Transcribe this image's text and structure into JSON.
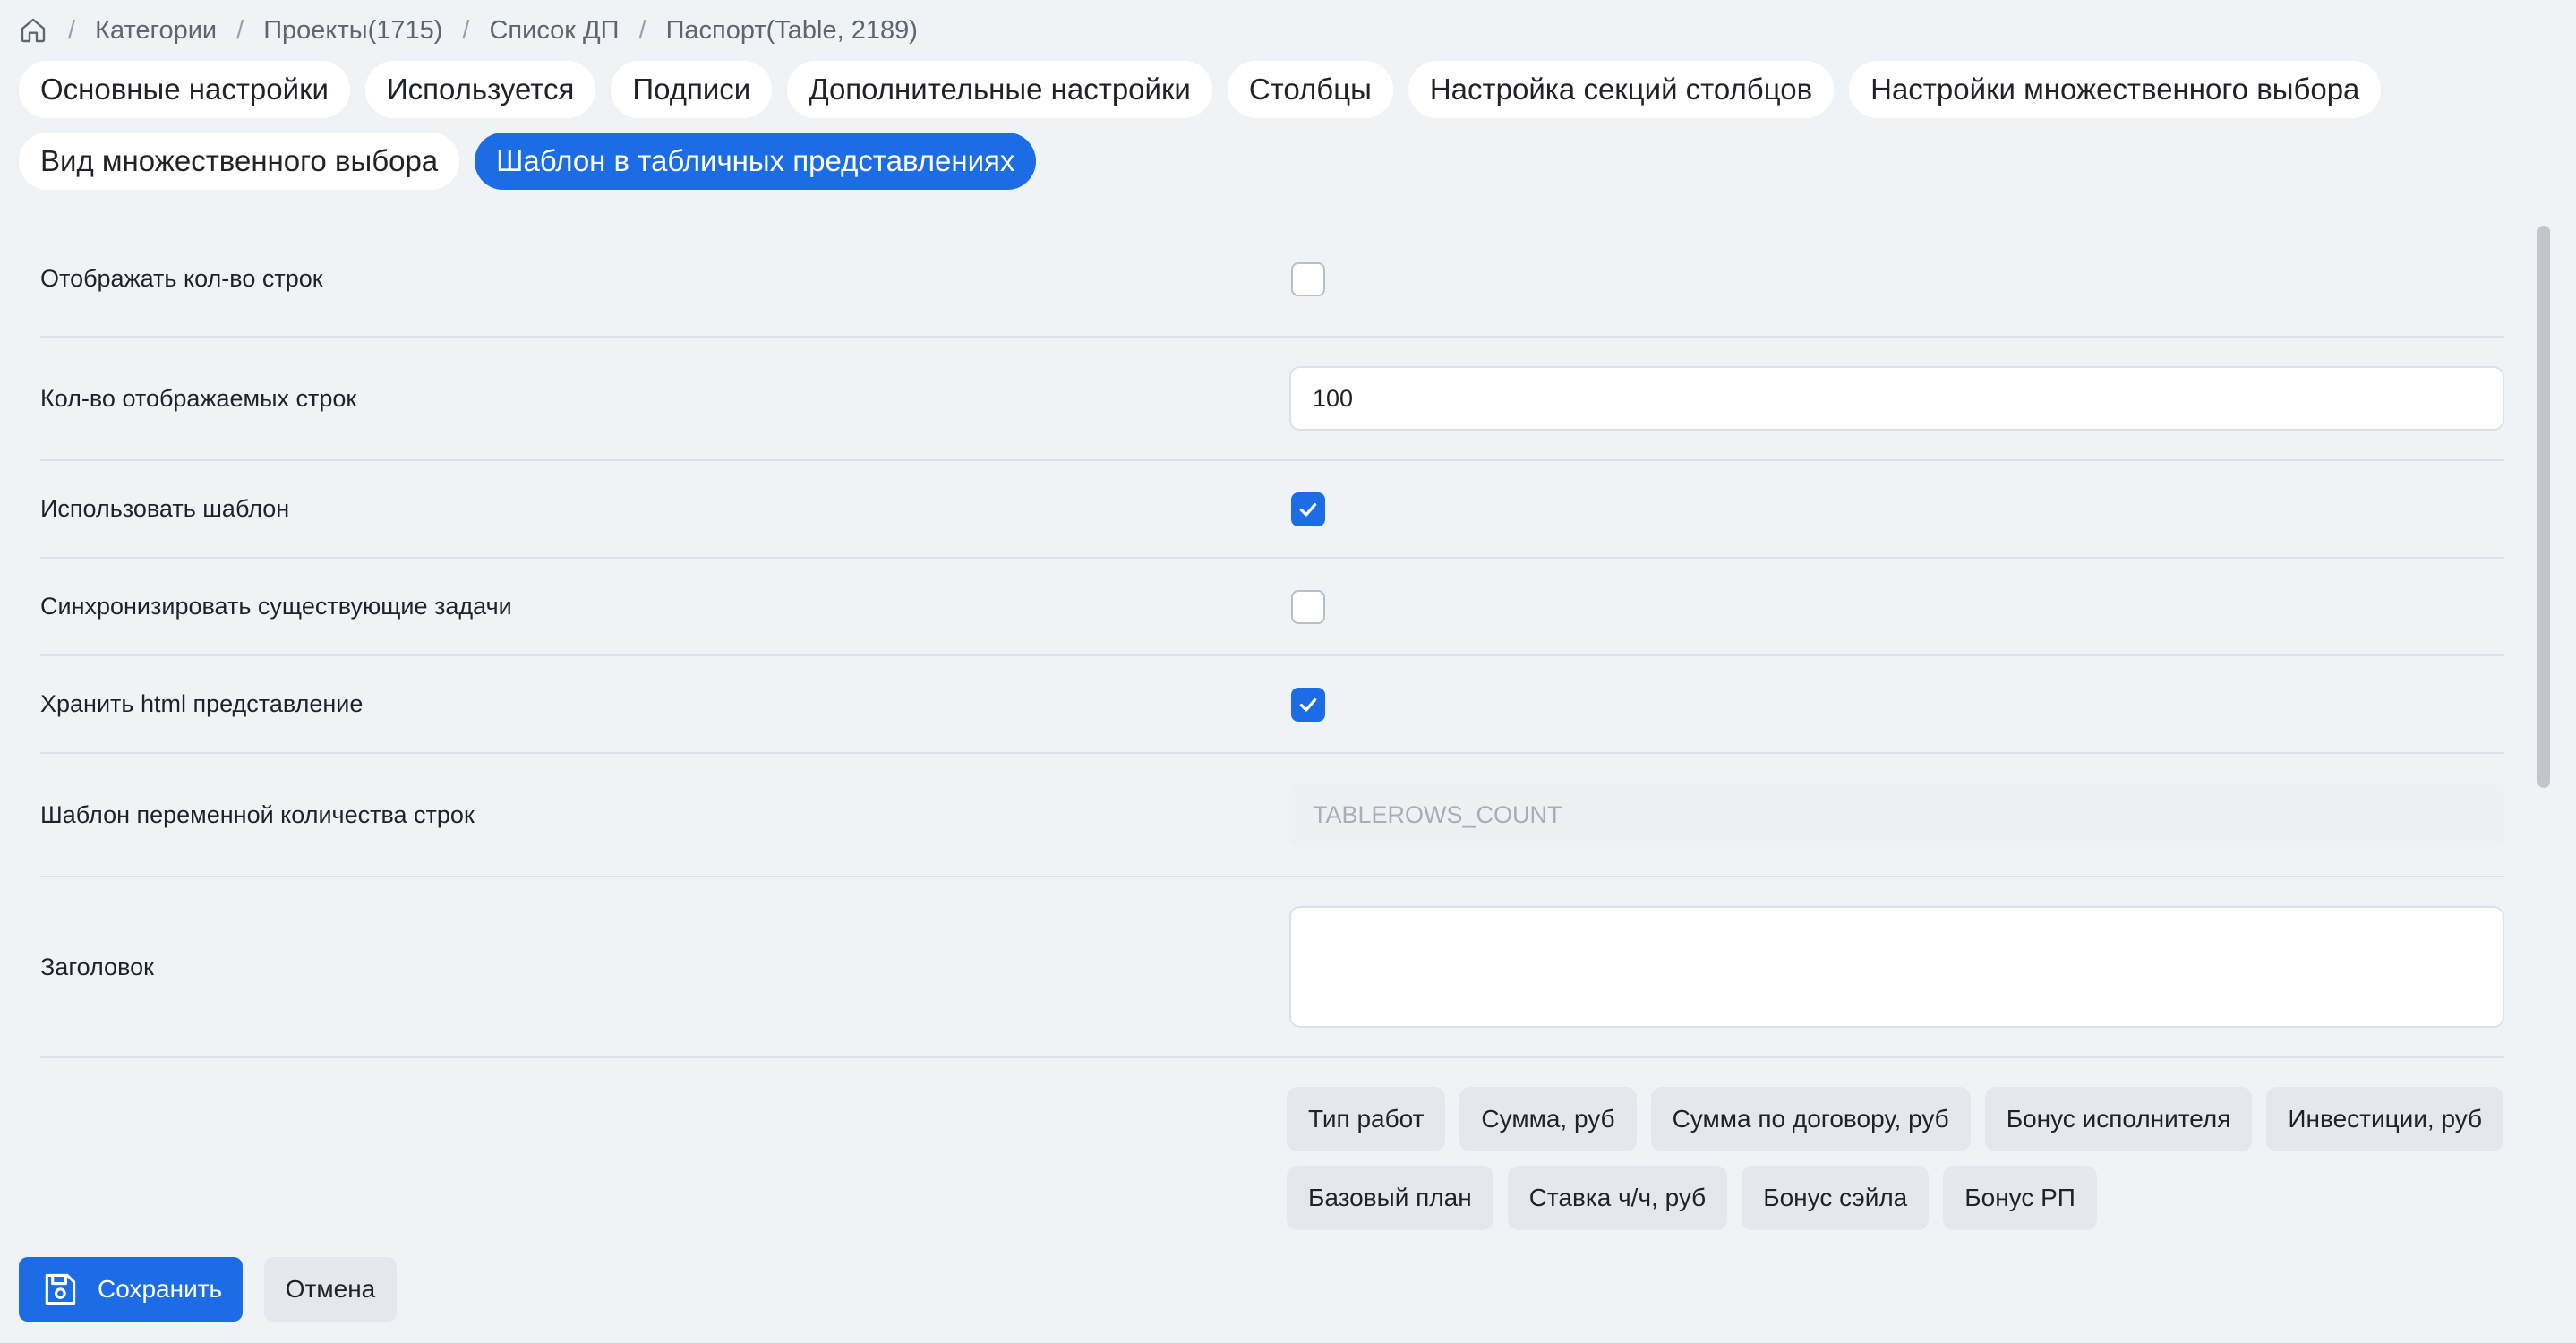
{
  "breadcrumb": {
    "home_icon": "home-icon",
    "items": [
      "Категории",
      "Проекты(1715)",
      "Список ДП",
      "Паспорт(Table, 2189)"
    ],
    "separator": "/"
  },
  "tabs": [
    {
      "label": "Основные настройки",
      "active": false
    },
    {
      "label": "Используется",
      "active": false
    },
    {
      "label": "Подписи",
      "active": false
    },
    {
      "label": "Дополнительные настройки",
      "active": false
    },
    {
      "label": "Столбцы",
      "active": false
    },
    {
      "label": "Настройка секций столбцов",
      "active": false
    },
    {
      "label": "Настройки множественного выбора",
      "active": false
    },
    {
      "label": "Вид множественного выбора",
      "active": false
    },
    {
      "label": "Шаблон в табличных представлениях",
      "active": true
    }
  ],
  "form": {
    "show_row_count": {
      "label": "Отображать кол-во строк",
      "checked": false
    },
    "rows_displayed": {
      "label": "Кол-во отображаемых строк",
      "value": "100"
    },
    "use_template": {
      "label": "Использовать шаблон",
      "checked": true
    },
    "sync_tasks": {
      "label": "Синхронизировать существующие задачи",
      "checked": false
    },
    "store_html": {
      "label": "Хранить html представление",
      "checked": true
    },
    "row_count_var": {
      "label": "Шаблон переменной количества строк",
      "placeholder": "TABLEROWS_COUNT"
    },
    "header": {
      "label": "Заголовок",
      "value": ""
    },
    "variables": [
      "Тип работ",
      "Сумма, руб",
      "Сумма по договору, руб",
      "Бонус исполнителя",
      "Инвестиции, руб",
      "Базовый план",
      "Ставка ч/ч, руб",
      "Бонус сэйла",
      "Бонус РП"
    ]
  },
  "footer": {
    "save_label": "Сохранить",
    "cancel_label": "Отмена"
  },
  "colors": {
    "accent": "#1c6ce6",
    "background": "#f0f3f6"
  }
}
